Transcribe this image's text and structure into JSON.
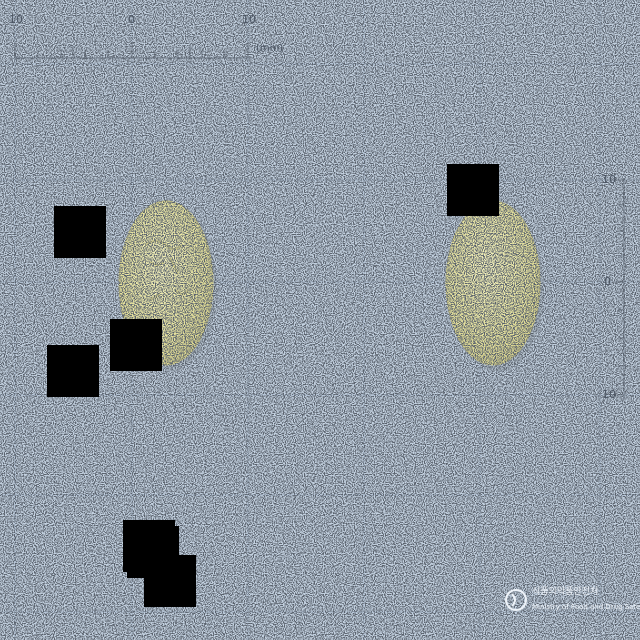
{
  "scale": {
    "top_labels": [
      "10",
      "0",
      "10"
    ],
    "unit": "(mm)",
    "right_labels": [
      "10",
      "0",
      "10"
    ]
  },
  "watermark": {
    "line1": "식품의약품안전처",
    "line2": "Ministry of Food and Drug Safety"
  },
  "pills": [
    {
      "side": "front",
      "shape": "oval",
      "color": "#e9e6a4",
      "imprint": "embossed marking"
    },
    {
      "side": "back",
      "shape": "oval",
      "color": "#e9e6a4"
    }
  ],
  "colors": {
    "background": "#c4d2e1",
    "grid": "#b0bfd0",
    "pill": "#e9e6a4",
    "redaction": "#000000"
  },
  "redaction_boxes": 7
}
